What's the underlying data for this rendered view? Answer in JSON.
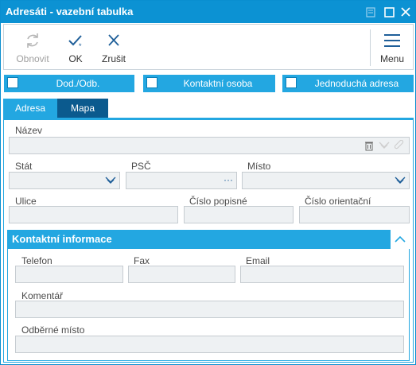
{
  "window": {
    "title": "Adresáti - vazební tabulka"
  },
  "toolbar": {
    "refresh_label": "Obnovit",
    "ok_label": "OK",
    "cancel_label": "Zrušit",
    "menu_label": "Menu"
  },
  "options": {
    "delivery_label": "Dod./Odb.",
    "contact_label": "Kontaktní osoba",
    "simple_label": "Jednoduchá adresa"
  },
  "tabs": {
    "address": "Adresa",
    "map": "Mapa"
  },
  "form": {
    "name_label": "Název",
    "country_label": "Stát",
    "zip_label": "PSČ",
    "city_label": "Místo",
    "street_label": "Ulice",
    "house_no_label": "Číslo popisné",
    "orient_no_label": "Číslo orientační"
  },
  "contact": {
    "section_title": "Kontaktní informace",
    "phone_label": "Telefon",
    "fax_label": "Fax",
    "email_label": "Email",
    "comment_label": "Komentář",
    "delivery_point_label": "Odběrné místo"
  },
  "colors": {
    "accent": "#23a7e1",
    "title_bar": "#0c92d3",
    "dark_tab": "#0b5a8e"
  }
}
